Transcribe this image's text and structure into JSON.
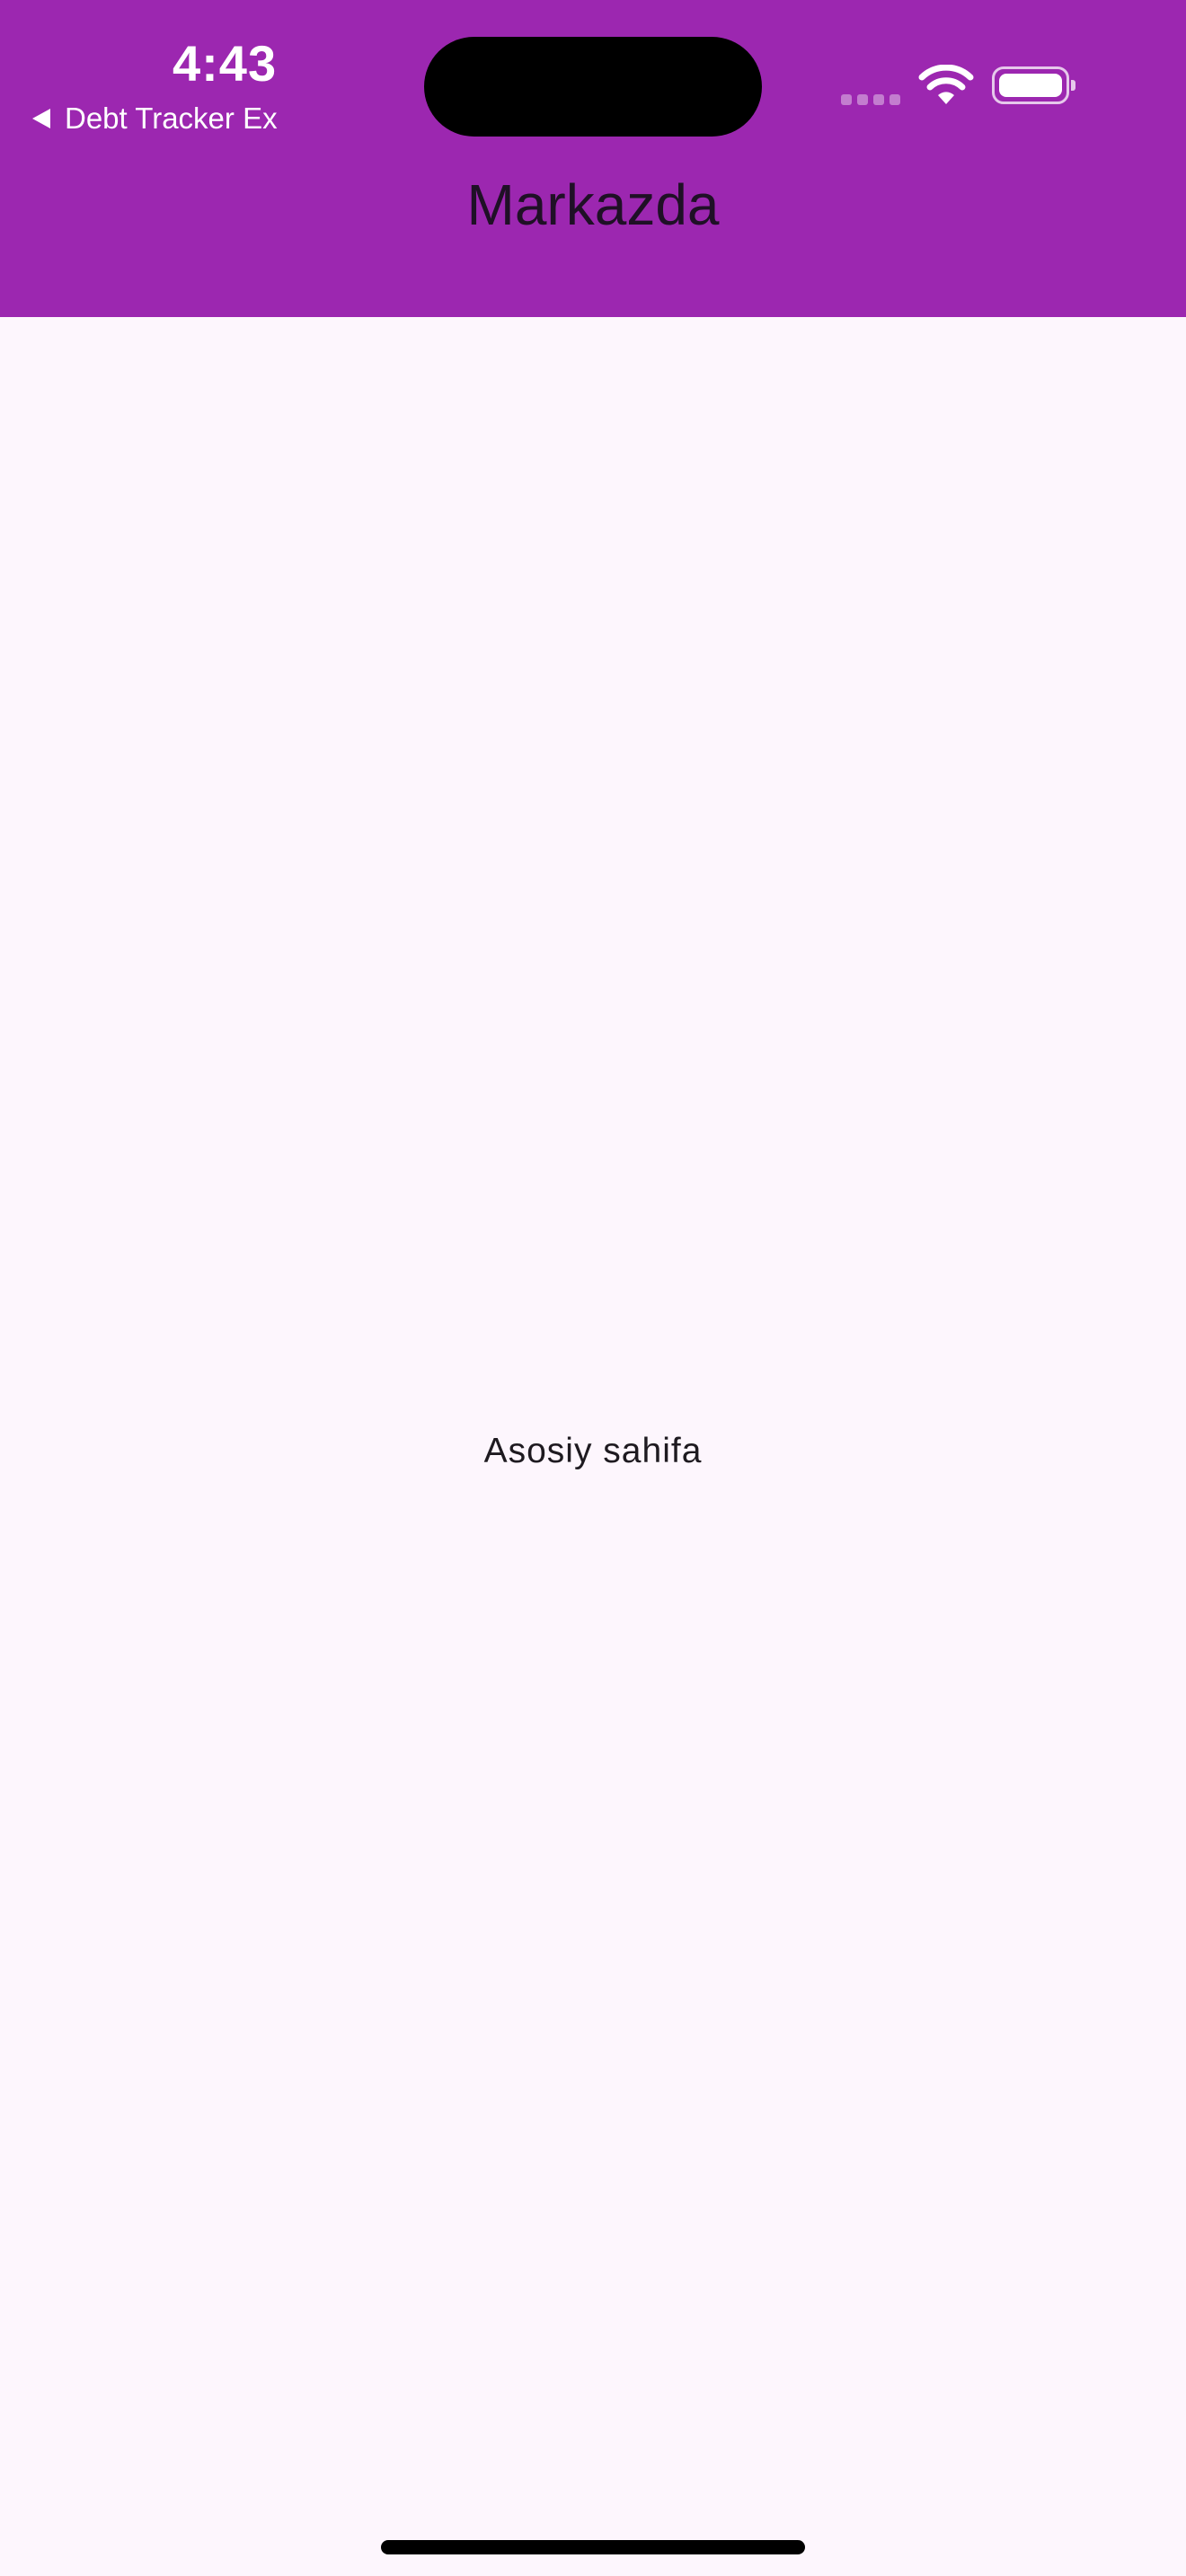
{
  "status_bar": {
    "time": "4:43",
    "back_label": "Debt Tracker Ex"
  },
  "app_bar": {
    "title": "Markazda",
    "color": "#9c27b0"
  },
  "body": {
    "text": "Asosiy sahifa",
    "background": "#fdf6fd"
  },
  "icons": {
    "back": "back-arrow-icon",
    "signal": "cellular-signal-icon",
    "wifi": "wifi-icon",
    "battery": "battery-icon"
  }
}
